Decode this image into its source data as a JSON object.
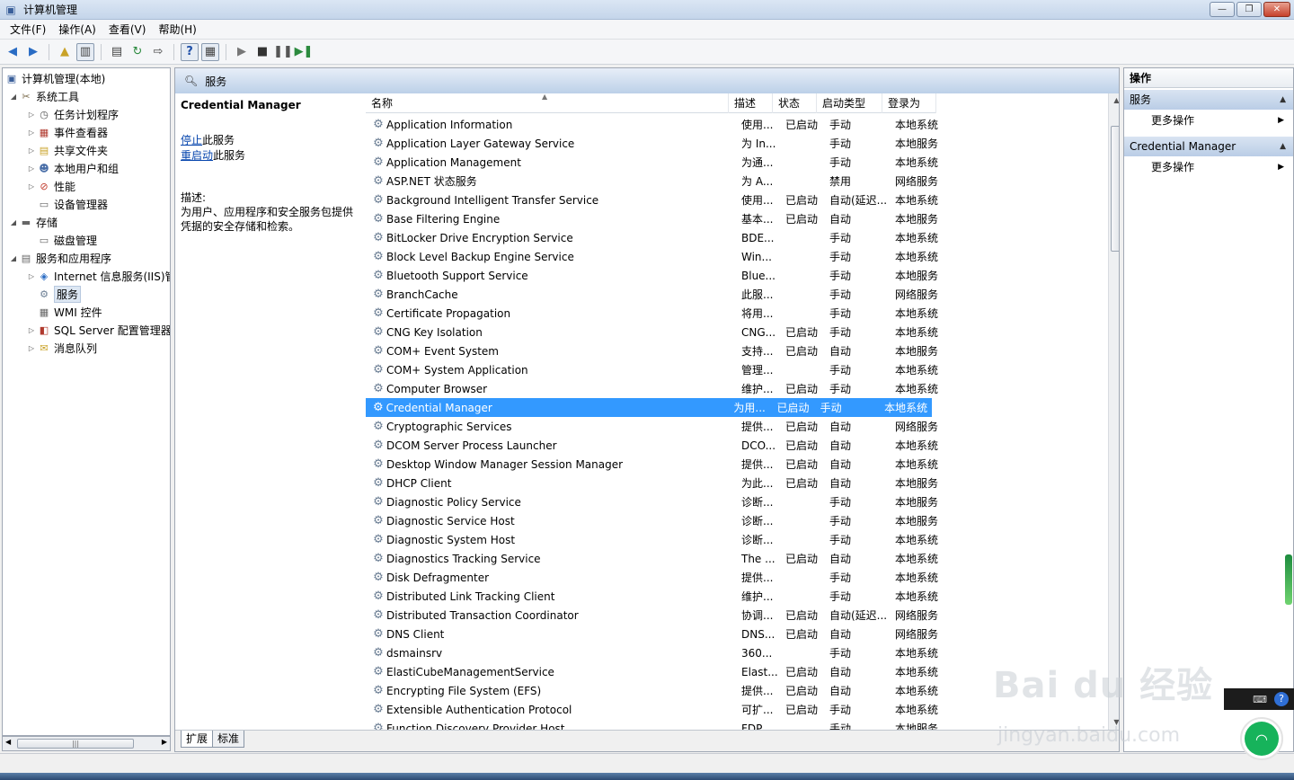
{
  "window": {
    "title": "计算机管理"
  },
  "menu": [
    "文件(F)",
    "操作(A)",
    "查看(V)",
    "帮助(H)"
  ],
  "tree": {
    "root": "计算机管理(本地)",
    "items": [
      {
        "label": "系统工具",
        "icon": "tools-icon",
        "level": 1,
        "expanded": true
      },
      {
        "label": "任务计划程序",
        "icon": "clock-icon",
        "level": 2,
        "expanded": false
      },
      {
        "label": "事件查看器",
        "icon": "event-viewer-icon",
        "level": 2,
        "expanded": false
      },
      {
        "label": "共享文件夹",
        "icon": "shared-folder-icon",
        "level": 2,
        "expanded": false
      },
      {
        "label": "本地用户和组",
        "icon": "users-icon",
        "level": 2,
        "expanded": false
      },
      {
        "label": "性能",
        "icon": "performance-icon",
        "level": 2,
        "expanded": false
      },
      {
        "label": "设备管理器",
        "icon": "device-manager-icon",
        "level": 2,
        "leaf": true
      },
      {
        "label": "存储",
        "icon": "storage-icon",
        "level": 1,
        "expanded": true
      },
      {
        "label": "磁盘管理",
        "icon": "disk-icon",
        "level": 2,
        "leaf": true
      },
      {
        "label": "服务和应用程序",
        "icon": "services-apps-icon",
        "level": 1,
        "expanded": true
      },
      {
        "label": "Internet 信息服务(IIS)管",
        "icon": "iis-icon",
        "level": 2,
        "expanded": false
      },
      {
        "label": "服务",
        "icon": "gear-icon",
        "level": 2,
        "leaf": true,
        "selected": true
      },
      {
        "label": "WMI 控件",
        "icon": "wmi-icon",
        "level": 2,
        "leaf": true
      },
      {
        "label": "SQL Server 配置管理器",
        "icon": "sql-server-icon",
        "level": 2,
        "expanded": false
      },
      {
        "label": "消息队列",
        "icon": "queue-icon",
        "level": 2,
        "expanded": false
      }
    ]
  },
  "services_header": "服务",
  "desc": {
    "name": "Credential Manager",
    "stop_link": "停止",
    "stop_suffix": "此服务",
    "restart_link": "重启动",
    "restart_suffix": "此服务",
    "label": "描述:",
    "text": "为用户、应用程序和安全服务包提供凭据的安全存储和检索。"
  },
  "columns": [
    "名称",
    "描述",
    "状态",
    "启动类型",
    "登录为"
  ],
  "rows": [
    [
      "Application Information",
      "使用...",
      "已启动",
      "手动",
      "本地系统"
    ],
    [
      "Application Layer Gateway Service",
      "为 In...",
      "",
      "手动",
      "本地服务"
    ],
    [
      "Application Management",
      "为通...",
      "",
      "手动",
      "本地系统"
    ],
    [
      "ASP.NET 状态服务",
      "为 A...",
      "",
      "禁用",
      "网络服务"
    ],
    [
      "Background Intelligent Transfer Service",
      "使用...",
      "已启动",
      "自动(延迟...",
      "本地系统"
    ],
    [
      "Base Filtering Engine",
      "基本...",
      "已启动",
      "自动",
      "本地服务"
    ],
    [
      "BitLocker Drive Encryption Service",
      "BDE...",
      "",
      "手动",
      "本地系统"
    ],
    [
      "Block Level Backup Engine Service",
      "Win...",
      "",
      "手动",
      "本地系统"
    ],
    [
      "Bluetooth Support Service",
      "Blue...",
      "",
      "手动",
      "本地服务"
    ],
    [
      "BranchCache",
      "此服...",
      "",
      "手动",
      "网络服务"
    ],
    [
      "Certificate Propagation",
      "将用...",
      "",
      "手动",
      "本地系统"
    ],
    [
      "CNG Key Isolation",
      "CNG...",
      "已启动",
      "手动",
      "本地系统"
    ],
    [
      "COM+ Event System",
      "支持...",
      "已启动",
      "自动",
      "本地服务"
    ],
    [
      "COM+ System Application",
      "管理...",
      "",
      "手动",
      "本地系统"
    ],
    [
      "Computer Browser",
      "维护...",
      "已启动",
      "手动",
      "本地系统"
    ],
    [
      "Credential Manager",
      "为用...",
      "已启动",
      "手动",
      "本地系统"
    ],
    [
      "Cryptographic Services",
      "提供...",
      "已启动",
      "自动",
      "网络服务"
    ],
    [
      "DCOM Server Process Launcher",
      "DCO...",
      "已启动",
      "自动",
      "本地系统"
    ],
    [
      "Desktop Window Manager Session Manager",
      "提供...",
      "已启动",
      "自动",
      "本地系统"
    ],
    [
      "DHCP Client",
      "为此...",
      "已启动",
      "自动",
      "本地服务"
    ],
    [
      "Diagnostic Policy Service",
      "诊断...",
      "",
      "手动",
      "本地服务"
    ],
    [
      "Diagnostic Service Host",
      "诊断...",
      "",
      "手动",
      "本地服务"
    ],
    [
      "Diagnostic System Host",
      "诊断...",
      "",
      "手动",
      "本地系统"
    ],
    [
      "Diagnostics Tracking Service",
      "The ...",
      "已启动",
      "自动",
      "本地系统"
    ],
    [
      "Disk Defragmenter",
      "提供...",
      "",
      "手动",
      "本地系统"
    ],
    [
      "Distributed Link Tracking Client",
      "维护...",
      "",
      "手动",
      "本地系统"
    ],
    [
      "Distributed Transaction Coordinator",
      "协调...",
      "已启动",
      "自动(延迟...",
      "网络服务"
    ],
    [
      "DNS Client",
      "DNS...",
      "已启动",
      "自动",
      "网络服务"
    ],
    [
      "dsmainsrv",
      "360...",
      "",
      "手动",
      "本地系统"
    ],
    [
      "ElastiCubeManagementService",
      "Elast...",
      "已启动",
      "自动",
      "本地系统"
    ],
    [
      "Encrypting File System (EFS)",
      "提供...",
      "已启动",
      "自动",
      "本地系统"
    ],
    [
      "Extensible Authentication Protocol",
      "可扩...",
      "已启动",
      "手动",
      "本地系统"
    ],
    [
      "Function Discovery Provider Host",
      "FDP...",
      "",
      "手动",
      "本地服务"
    ]
  ],
  "selected_row": 15,
  "tabs": [
    "扩展",
    "标准"
  ],
  "actions": {
    "title": "操作",
    "sections": [
      {
        "label": "服务",
        "item": "更多操作"
      },
      {
        "label": "Credential Manager",
        "item": "更多操作"
      }
    ]
  },
  "watermark": {
    "brand": "Bai  du 经验",
    "url": "jingyan.baidu.com"
  }
}
